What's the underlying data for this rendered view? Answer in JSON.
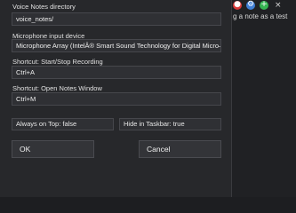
{
  "background_app": {
    "note_text": "g a note as a test",
    "icons": [
      {
        "name": "record-icon",
        "color": "#d93b3b",
        "glyph": "●"
      },
      {
        "name": "gear-icon",
        "color": "#3f7fd6",
        "glyph": "⚙"
      },
      {
        "name": "add-icon",
        "color": "#35b551",
        "glyph": "+"
      }
    ],
    "close_glyph": "×"
  },
  "settings": {
    "notes_dir": {
      "label": "Voice Notes directory",
      "value": "voice_notes/"
    },
    "mic": {
      "label": "Microphone input device",
      "value": "Microphone Array (IntelÂ® Smart Sound Technology for Digital Micro—"
    },
    "shortcut_record": {
      "label": "Shortcut: Start/Stop Recording",
      "value": "Ctrl+A"
    },
    "shortcut_notes": {
      "label": "Shortcut: Open Notes Window",
      "value": "Ctrl+M"
    },
    "always_on_top": "Always on Top: false",
    "hide_in_taskbar": "Hide in Taskbar: true"
  },
  "buttons": {
    "ok": "OK",
    "cancel": "Cancel"
  }
}
